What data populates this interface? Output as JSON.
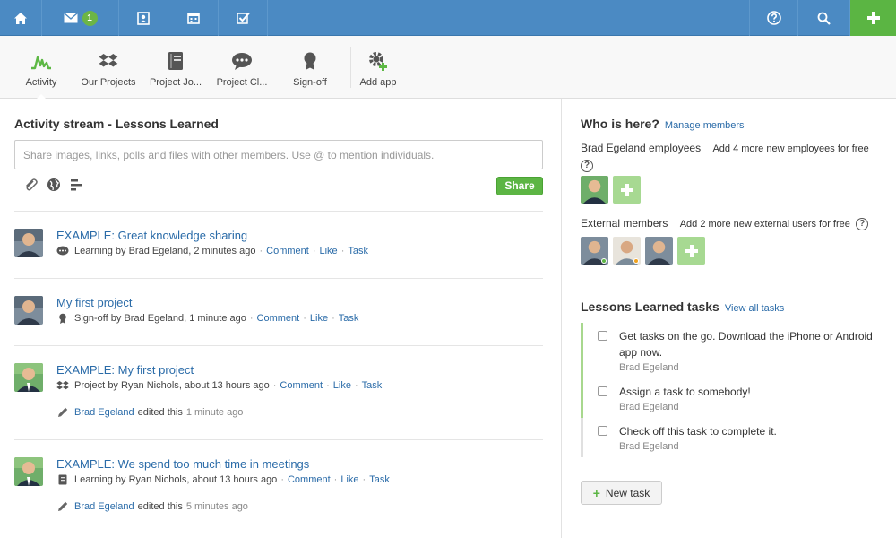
{
  "topbar": {
    "mail_badge": "1",
    "colors": {
      "bar": "#4b8ac3",
      "plus": "#5bb543"
    }
  },
  "apps": [
    {
      "label": "Activity",
      "icon": "activity-icon"
    },
    {
      "label": "Our Projects",
      "icon": "dropbox-icon"
    },
    {
      "label": "Project Jo...",
      "icon": "notebook-icon"
    },
    {
      "label": "Project Cl...",
      "icon": "chat-icon"
    },
    {
      "label": "Sign-off",
      "icon": "award-icon"
    },
    {
      "label": "Add app",
      "icon": "gear-plus-icon"
    }
  ],
  "stream": {
    "title": "Activity stream - Lessons Learned",
    "placeholder": "Share images, links, polls and files with other members. Use @ to mention individuals.",
    "share_label": "Share",
    "entries": [
      {
        "title": "EXAMPLE: Great knowledge sharing",
        "app": "Learning",
        "by": "by",
        "author": "Brad Egeland",
        "time": ", 2 minutes ago",
        "comment": "Comment",
        "like": "Like",
        "task": "Task"
      },
      {
        "title": "My first project",
        "app": "Sign-off",
        "by": "by",
        "author": "Brad Egeland",
        "time": ", 1 minute ago",
        "comment": "Comment",
        "like": "Like",
        "task": "Task"
      },
      {
        "title": "EXAMPLE: My first project",
        "app": "Project",
        "by": "by",
        "author": "Ryan Nichols",
        "time": ", about 13 hours ago",
        "comment": "Comment",
        "like": "Like",
        "task": "Task",
        "edited_by": "Brad Egeland",
        "edited_text": "edited this",
        "edited_ago": "1 minute ago"
      },
      {
        "title": "EXAMPLE: We spend too much time in meetings",
        "app": "Learning",
        "by": "by",
        "author": "Ryan Nichols",
        "time": ", about 13 hours ago",
        "comment": "Comment",
        "like": "Like",
        "task": "Task",
        "edited_by": "Brad Egeland",
        "edited_text": "edited this",
        "edited_ago": "5 minutes ago"
      }
    ]
  },
  "who": {
    "title": "Who is here?",
    "manage": "Manage members",
    "employees_label": "Brad Egeland employees",
    "employees_note": "Add 4 more new employees for free",
    "external_label": "External members",
    "external_note": "Add 2 more new external users for free"
  },
  "tasks": {
    "title": "Lessons Learned tasks",
    "view_all": "View all tasks",
    "items": [
      {
        "text": "Get tasks on the go. Download the iPhone or Android app now.",
        "author": "Brad Egeland"
      },
      {
        "text": "Assign a task to somebody!",
        "author": "Brad Egeland"
      },
      {
        "text": "Check off this task to complete it.",
        "author": "Brad Egeland"
      }
    ],
    "new_task": "New task"
  }
}
